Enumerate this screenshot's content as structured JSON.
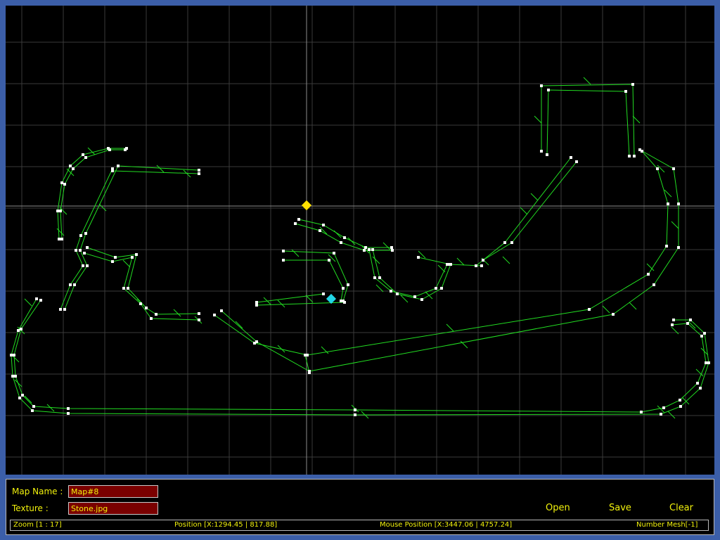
{
  "map_editor": {
    "grid_visible": true,
    "track_color": "#22dd22",
    "vertex_color": "#ffffff",
    "marker_start_color": "#ffe000",
    "marker_current_color": "#22d6e6"
  },
  "panel": {
    "map_name_label": "Map Name :",
    "map_name_value": "Map#8",
    "texture_label": "Texture :",
    "texture_value": "Stone.jpg",
    "open_label": "Open",
    "save_label": "Save",
    "clear_label": "Clear"
  },
  "status": {
    "zoom": "Zoom [1 : 17]",
    "position": "Position [X:1294.45 | 817.88]",
    "mouse_position": "Mouse Position [X:3447.06 | 4757.24]",
    "number_mesh": "Number Mesh[-1]"
  }
}
